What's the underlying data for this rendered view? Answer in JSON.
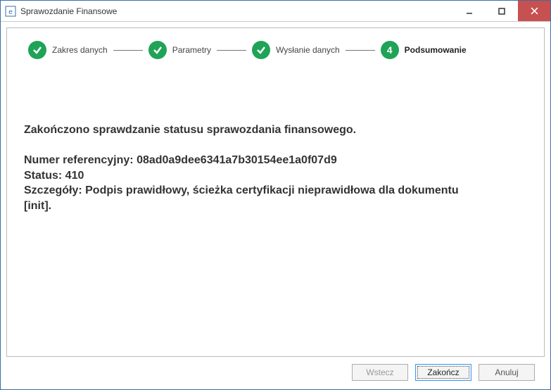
{
  "titlebar": {
    "title": "Sprawozdanie Finansowe"
  },
  "steps": {
    "s1": {
      "label": "Zakres danych"
    },
    "s2": {
      "label": "Parametry"
    },
    "s3": {
      "label": "Wysłanie danych"
    },
    "s4": {
      "num": "4",
      "label": "Podsumowanie"
    }
  },
  "content": {
    "message": "Zakończono sprawdzanie statusu sprawozdania finansowego.\n\nNumer referencyjny: 08ad0a9dee6341a7b30154ee1a0f07d9\nStatus: 410\nSzczegóły: Podpis prawidłowy, ścieżka certyfikacji nieprawidłowa dla dokumentu [init]."
  },
  "footer": {
    "back": "Wstecz",
    "finish": "Zakończ",
    "cancel": "Anuluj"
  }
}
